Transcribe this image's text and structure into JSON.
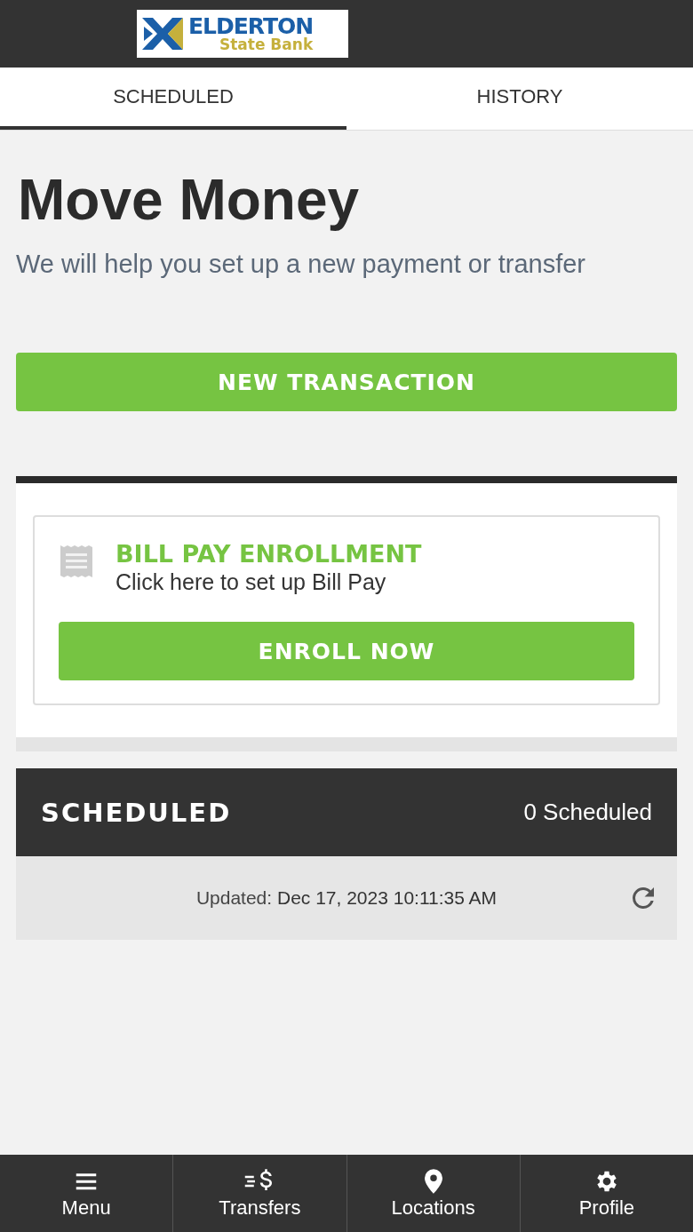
{
  "header": {
    "logo": {
      "name": "ELDERTON",
      "subtitle": "State Bank"
    }
  },
  "tabs": [
    {
      "label": "SCHEDULED",
      "selected": true
    },
    {
      "label": "HISTORY",
      "selected": false
    }
  ],
  "page": {
    "title": "Move Money",
    "subtitle": "We will help you set up a new payment or transfer"
  },
  "primary_button": "NEW TRANSACTION",
  "enrollment_card": {
    "title": "BILL PAY ENROLLMENT",
    "description": "Click here to set up Bill Pay",
    "button": "ENROLL NOW"
  },
  "scheduled": {
    "title": "SCHEDULED",
    "count": "0 Scheduled",
    "updated": "Updated: **Dec 17, 2023 10:11:35 AM**"
  },
  "bottom_nav": [
    {
      "kind": "menu",
      "label": "Menu"
    },
    {
      "kind": "transfers",
      "label": "Transfers"
    },
    {
      "kind": "locations",
      "label": "Locations"
    },
    {
      "kind": "profile",
      "label": "Profile"
    }
  ]
}
